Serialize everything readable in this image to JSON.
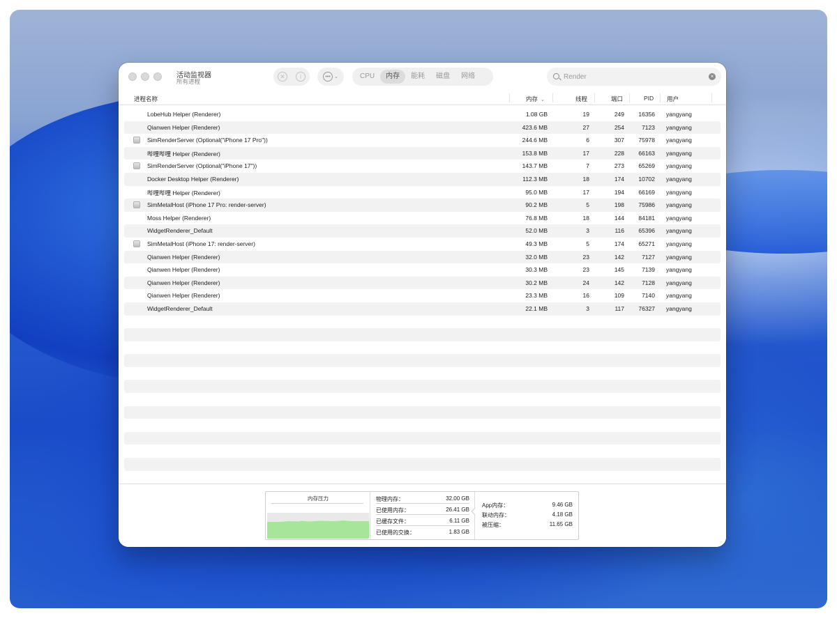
{
  "window": {
    "title": "活动监视器",
    "subtitle": "所有进程"
  },
  "toolbar": {
    "stop_icon": "stop-process-icon",
    "info_icon": "info-icon",
    "more_icon": "more-options-icon",
    "tabs": [
      {
        "label": "CPU",
        "active": false
      },
      {
        "label": "内存",
        "active": true
      },
      {
        "label": "能耗",
        "active": false
      },
      {
        "label": "磁盘",
        "active": false
      },
      {
        "label": "网络",
        "active": false
      }
    ],
    "search_value": "Render"
  },
  "table": {
    "columns": {
      "name": "进程名称",
      "memory": "内存",
      "threads": "线程",
      "ports": "端口",
      "pid": "PID",
      "user": "用户"
    },
    "rows": [
      {
        "name": "LobeHub Helper (Renderer)",
        "mem": "1.08 GB",
        "threads": "19",
        "ports": "249",
        "pid": "16356",
        "user": "yangyang",
        "icon": false
      },
      {
        "name": "Qianwen Helper (Renderer)",
        "mem": "423.6 MB",
        "threads": "27",
        "ports": "254",
        "pid": "7123",
        "user": "yangyang",
        "icon": false
      },
      {
        "name": "SimRenderServer (Optional(\"iPhone 17 Pro\"))",
        "mem": "244.6 MB",
        "threads": "6",
        "ports": "307",
        "pid": "75978",
        "user": "yangyang",
        "icon": true
      },
      {
        "name": "哔哩哔哩 Helper (Renderer)",
        "mem": "153.8 MB",
        "threads": "17",
        "ports": "228",
        "pid": "66163",
        "user": "yangyang",
        "icon": false
      },
      {
        "name": "SimRenderServer (Optional(\"iPhone 17\"))",
        "mem": "143.7 MB",
        "threads": "7",
        "ports": "273",
        "pid": "65269",
        "user": "yangyang",
        "icon": true
      },
      {
        "name": "Docker Desktop Helper (Renderer)",
        "mem": "112.3 MB",
        "threads": "18",
        "ports": "174",
        "pid": "10702",
        "user": "yangyang",
        "icon": false
      },
      {
        "name": "哔哩哔哩 Helper (Renderer)",
        "mem": "95.0 MB",
        "threads": "17",
        "ports": "194",
        "pid": "66169",
        "user": "yangyang",
        "icon": false
      },
      {
        "name": "SimMetalHost (iPhone 17 Pro: render-server)",
        "mem": "90.2 MB",
        "threads": "5",
        "ports": "198",
        "pid": "75986",
        "user": "yangyang",
        "icon": true
      },
      {
        "name": "Moss Helper (Renderer)",
        "mem": "76.8 MB",
        "threads": "18",
        "ports": "144",
        "pid": "84181",
        "user": "yangyang",
        "icon": false
      },
      {
        "name": "WidgetRenderer_Default",
        "mem": "52.0 MB",
        "threads": "3",
        "ports": "116",
        "pid": "65396",
        "user": "yangyang",
        "icon": false
      },
      {
        "name": "SimMetalHost (iPhone 17: render-server)",
        "mem": "49.3 MB",
        "threads": "5",
        "ports": "174",
        "pid": "65271",
        "user": "yangyang",
        "icon": true
      },
      {
        "name": "Qianwen Helper (Renderer)",
        "mem": "32.0 MB",
        "threads": "23",
        "ports": "142",
        "pid": "7127",
        "user": "yangyang",
        "icon": false
      },
      {
        "name": "Qianwen Helper (Renderer)",
        "mem": "30.3 MB",
        "threads": "23",
        "ports": "145",
        "pid": "7139",
        "user": "yangyang",
        "icon": false
      },
      {
        "name": "Qianwen Helper (Renderer)",
        "mem": "30.2 MB",
        "threads": "24",
        "ports": "142",
        "pid": "7128",
        "user": "yangyang",
        "icon": false
      },
      {
        "name": "Qianwen Helper (Renderer)",
        "mem": "23.3 MB",
        "threads": "16",
        "ports": "109",
        "pid": "7140",
        "user": "yangyang",
        "icon": false
      },
      {
        "name": "WidgetRenderer_Default",
        "mem": "22.1 MB",
        "threads": "3",
        "ports": "117",
        "pid": "76327",
        "user": "yangyang",
        "icon": false
      }
    ]
  },
  "stats": {
    "pressure_title": "内存压力",
    "pressure_color": "#a6e59a",
    "physical_label": "物理内存：",
    "physical_value": "32.00 GB",
    "used_label": "已使用内存：",
    "used_value": "26.41 GB",
    "cached_label": "已缓存文件：",
    "cached_value": "6.11 GB",
    "swap_label": "已使用的交换：",
    "swap_value": "1.83 GB",
    "app_label": "App内存：",
    "app_value": "9.46 GB",
    "wired_label": "联动内存：",
    "wired_value": "4.18 GB",
    "compressed_label": "被压缩：",
    "compressed_value": "11.65 GB"
  }
}
